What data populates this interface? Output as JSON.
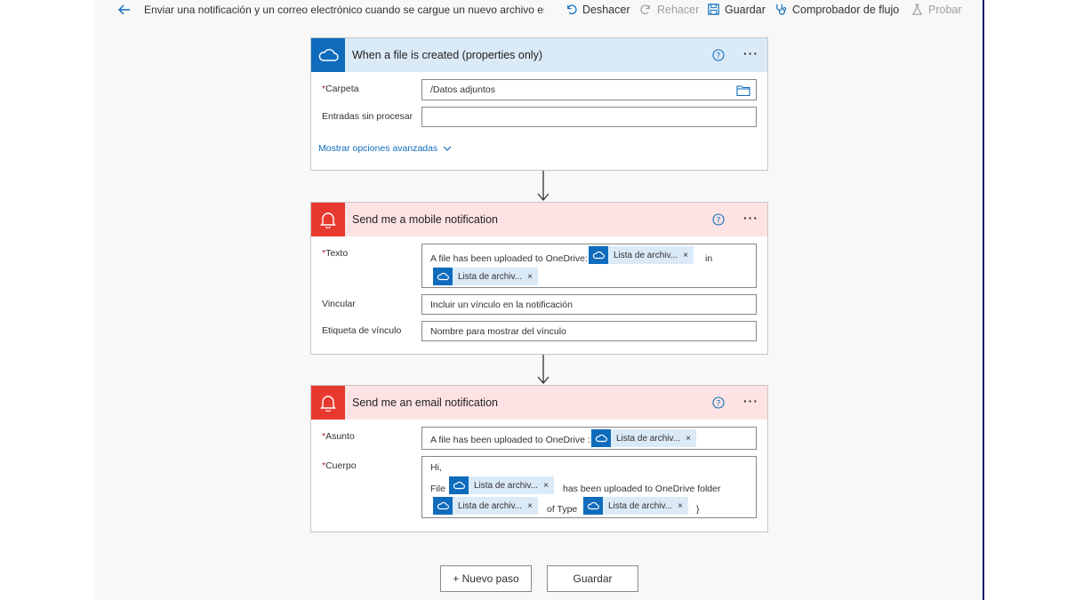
{
  "toolbar": {
    "flow_title": "Enviar una notificación y un correo electrónico cuando se cargue un nuevo archivo er",
    "undo": "Deshacer",
    "redo": "Rehacer",
    "save": "Guardar",
    "flow_checker": "Comprobador de flujo",
    "test": "Probar"
  },
  "trigger": {
    "title": "When a file is created (properties only)",
    "folder_label": "Carpeta",
    "folder_value": "/Datos adjuntos",
    "raw_label": "Entradas sin procesar",
    "advanced_label": "Mostrar opciones avanzadas"
  },
  "mobile": {
    "title": "Send me a mobile notification",
    "text_label": "Texto",
    "text_prefix": "A file has been uploaded to OneDrive:",
    "token1": "Lista de archiv...",
    "text_in": "in",
    "token2": "Lista de archiv...",
    "link_label": "Vincular",
    "link_placeholder": "Incluir un vínculo en la notificación",
    "link_tag_label": "Etiqueta de vínculo",
    "link_tag_placeholder": "Nombre para mostrar del vínculo"
  },
  "email": {
    "title": "Send me an email notification",
    "subject_label": "Asunto",
    "subject_prefix": "A file has been uploaded to OneDrive :",
    "subject_token": "Lista de archiv...",
    "body_label": "Cuerpo",
    "body_hi": "Hi,",
    "body_file": "File",
    "body_token1": "Lista de archiv...",
    "body_uploaded": "has been uploaded to OneDrive folder",
    "body_token2": "Lista de archiv...",
    "body_of_type": "of Type",
    "body_token3": "Lista de archiv...",
    "body_close": "}"
  },
  "required_mark": "*",
  "token_remove": "×",
  "more_menu": "···",
  "footer": {
    "new_step": "+ Nuevo paso",
    "save": "Guardar"
  },
  "colors": {
    "onedrive_blue": "#0f6cbd",
    "notification_red": "#e8392f",
    "trigger_header": "#dbeaf7",
    "action_header": "#fde3e3"
  }
}
